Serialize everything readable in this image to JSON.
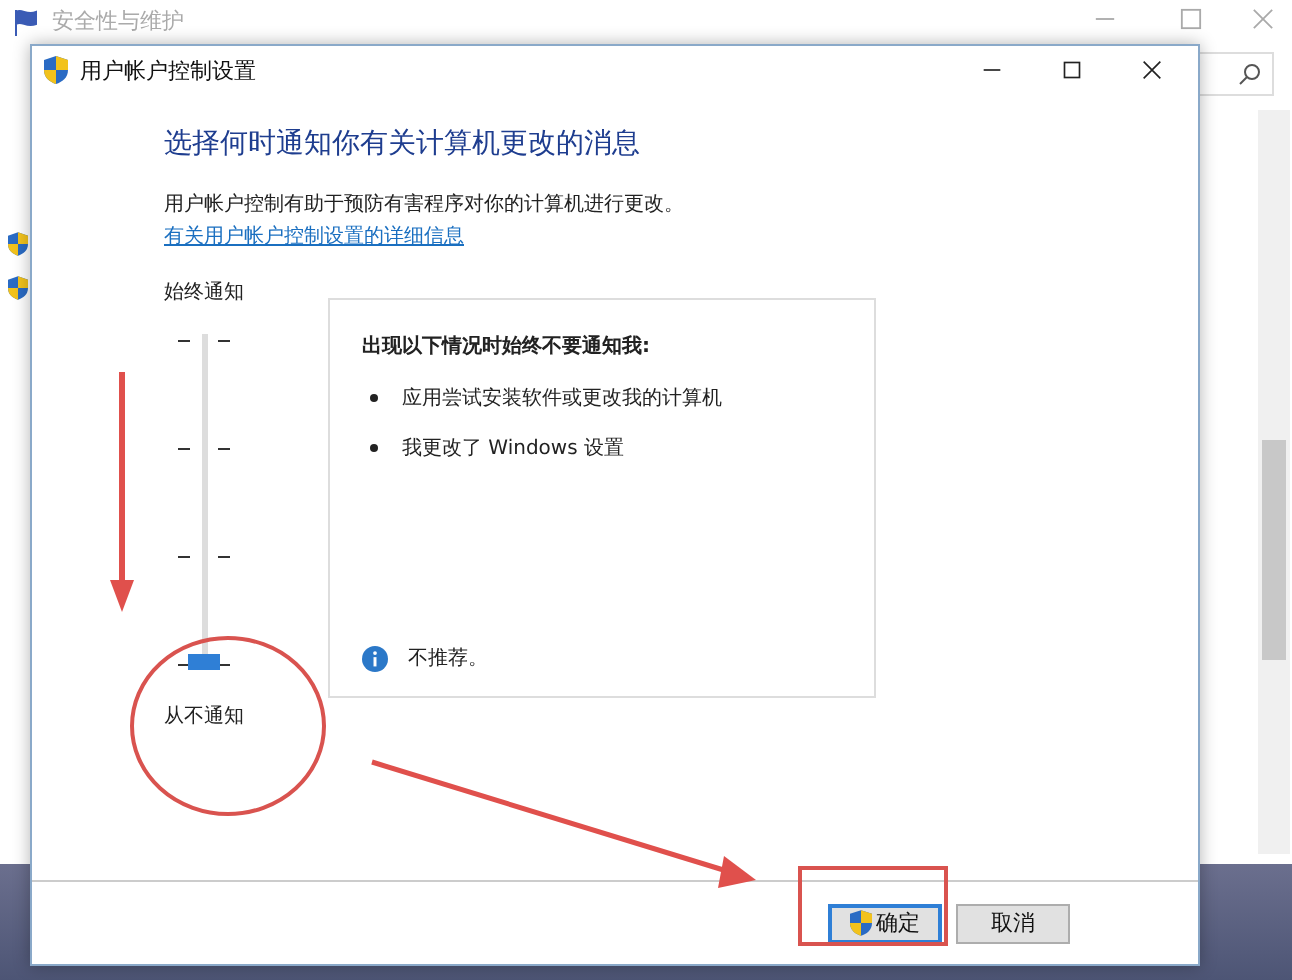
{
  "background_window": {
    "title": "安全性与维护"
  },
  "dialog": {
    "title": "用户帐户控制设置",
    "heading": "选择何时通知你有关计算机更改的消息",
    "description": "用户帐户控制有助于预防有害程序对你的计算机进行更改。",
    "link": "有关用户帐户控制设置的详细信息",
    "slider": {
      "top_label": "始终通知",
      "bottom_label": "从不通知",
      "level": 0
    },
    "info_panel": {
      "heading": "出现以下情况时始终不要通知我:",
      "bullets": [
        "应用尝试安装软件或更改我的计算机",
        "我更改了 Windows 设置"
      ],
      "note": "不推荐。"
    },
    "buttons": [
      {
        "label": "确定",
        "kind": "shield",
        "focused": true
      },
      {
        "label": "取消",
        "kind": "plain",
        "focused": false
      }
    ]
  }
}
